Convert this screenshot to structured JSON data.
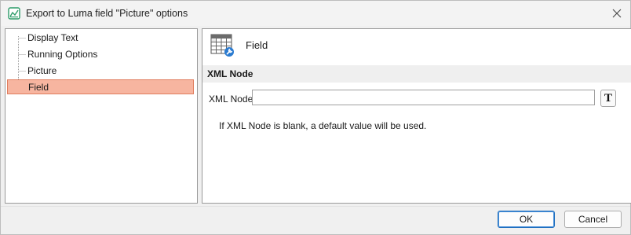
{
  "window": {
    "title": "Export to Luma field \"Picture\" options",
    "app_icon": "chart-app-icon",
    "close_icon": "close-icon"
  },
  "tree": {
    "items": [
      {
        "label": "Display Text",
        "selected": false
      },
      {
        "label": "Running Options",
        "selected": false
      },
      {
        "label": "Picture",
        "selected": false
      },
      {
        "label": "Field",
        "selected": true
      }
    ]
  },
  "content": {
    "header_title": "Field",
    "header_icon": "table-wrench-icon",
    "section_title": "XML Node",
    "field_label": "XML Node",
    "field_value": "",
    "t_button_label": "T",
    "hint": "If XML Node is blank, a default value will be used."
  },
  "footer": {
    "ok_label": "OK",
    "cancel_label": "Cancel"
  },
  "colors": {
    "selection_fill": "#f7b5a0",
    "selection_border": "#e07d5e",
    "default_button_border": "#1f6fbf"
  }
}
